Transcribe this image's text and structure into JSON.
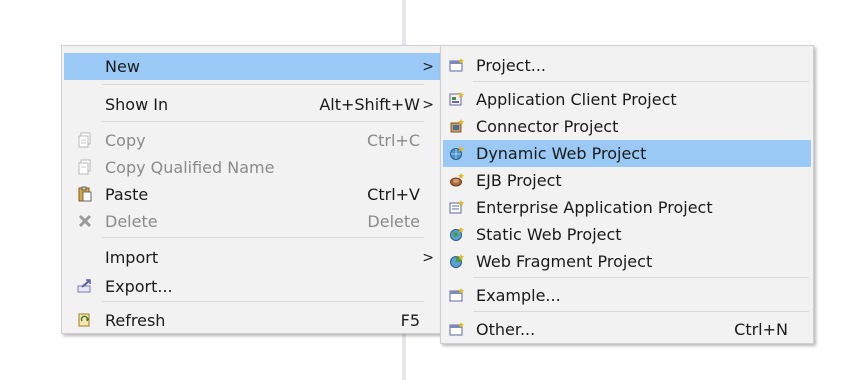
{
  "main_menu": {
    "new_label": "New",
    "show_in_label": "Show In",
    "show_in_accel": "Alt+Shift+W",
    "copy_label": "Copy",
    "copy_accel": "Ctrl+C",
    "copy_qualified_label": "Copy Qualified Name",
    "paste_label": "Paste",
    "paste_accel": "Ctrl+V",
    "delete_label": "Delete",
    "delete_accel": "Delete",
    "import_label": "Import",
    "export_label": "Export...",
    "refresh_label": "Refresh",
    "refresh_accel": "F5",
    "submenu_arrow": ">"
  },
  "sub_menu": {
    "project_label": "Project...",
    "app_client_label": "Application Client Project",
    "connector_label": "Connector Project",
    "dynamic_web_label": "Dynamic Web Project",
    "ejb_label": "EJB Project",
    "enterprise_app_label": "Enterprise Application Project",
    "static_web_label": "Static Web Project",
    "web_fragment_label": "Web Fragment Project",
    "example_label": "Example...",
    "other_label": "Other...",
    "other_accel": "Ctrl+N"
  },
  "colors": {
    "selection": "#99c9f4",
    "menu_bg": "#f2f2f2",
    "disabled_text": "#8a8a8a"
  }
}
